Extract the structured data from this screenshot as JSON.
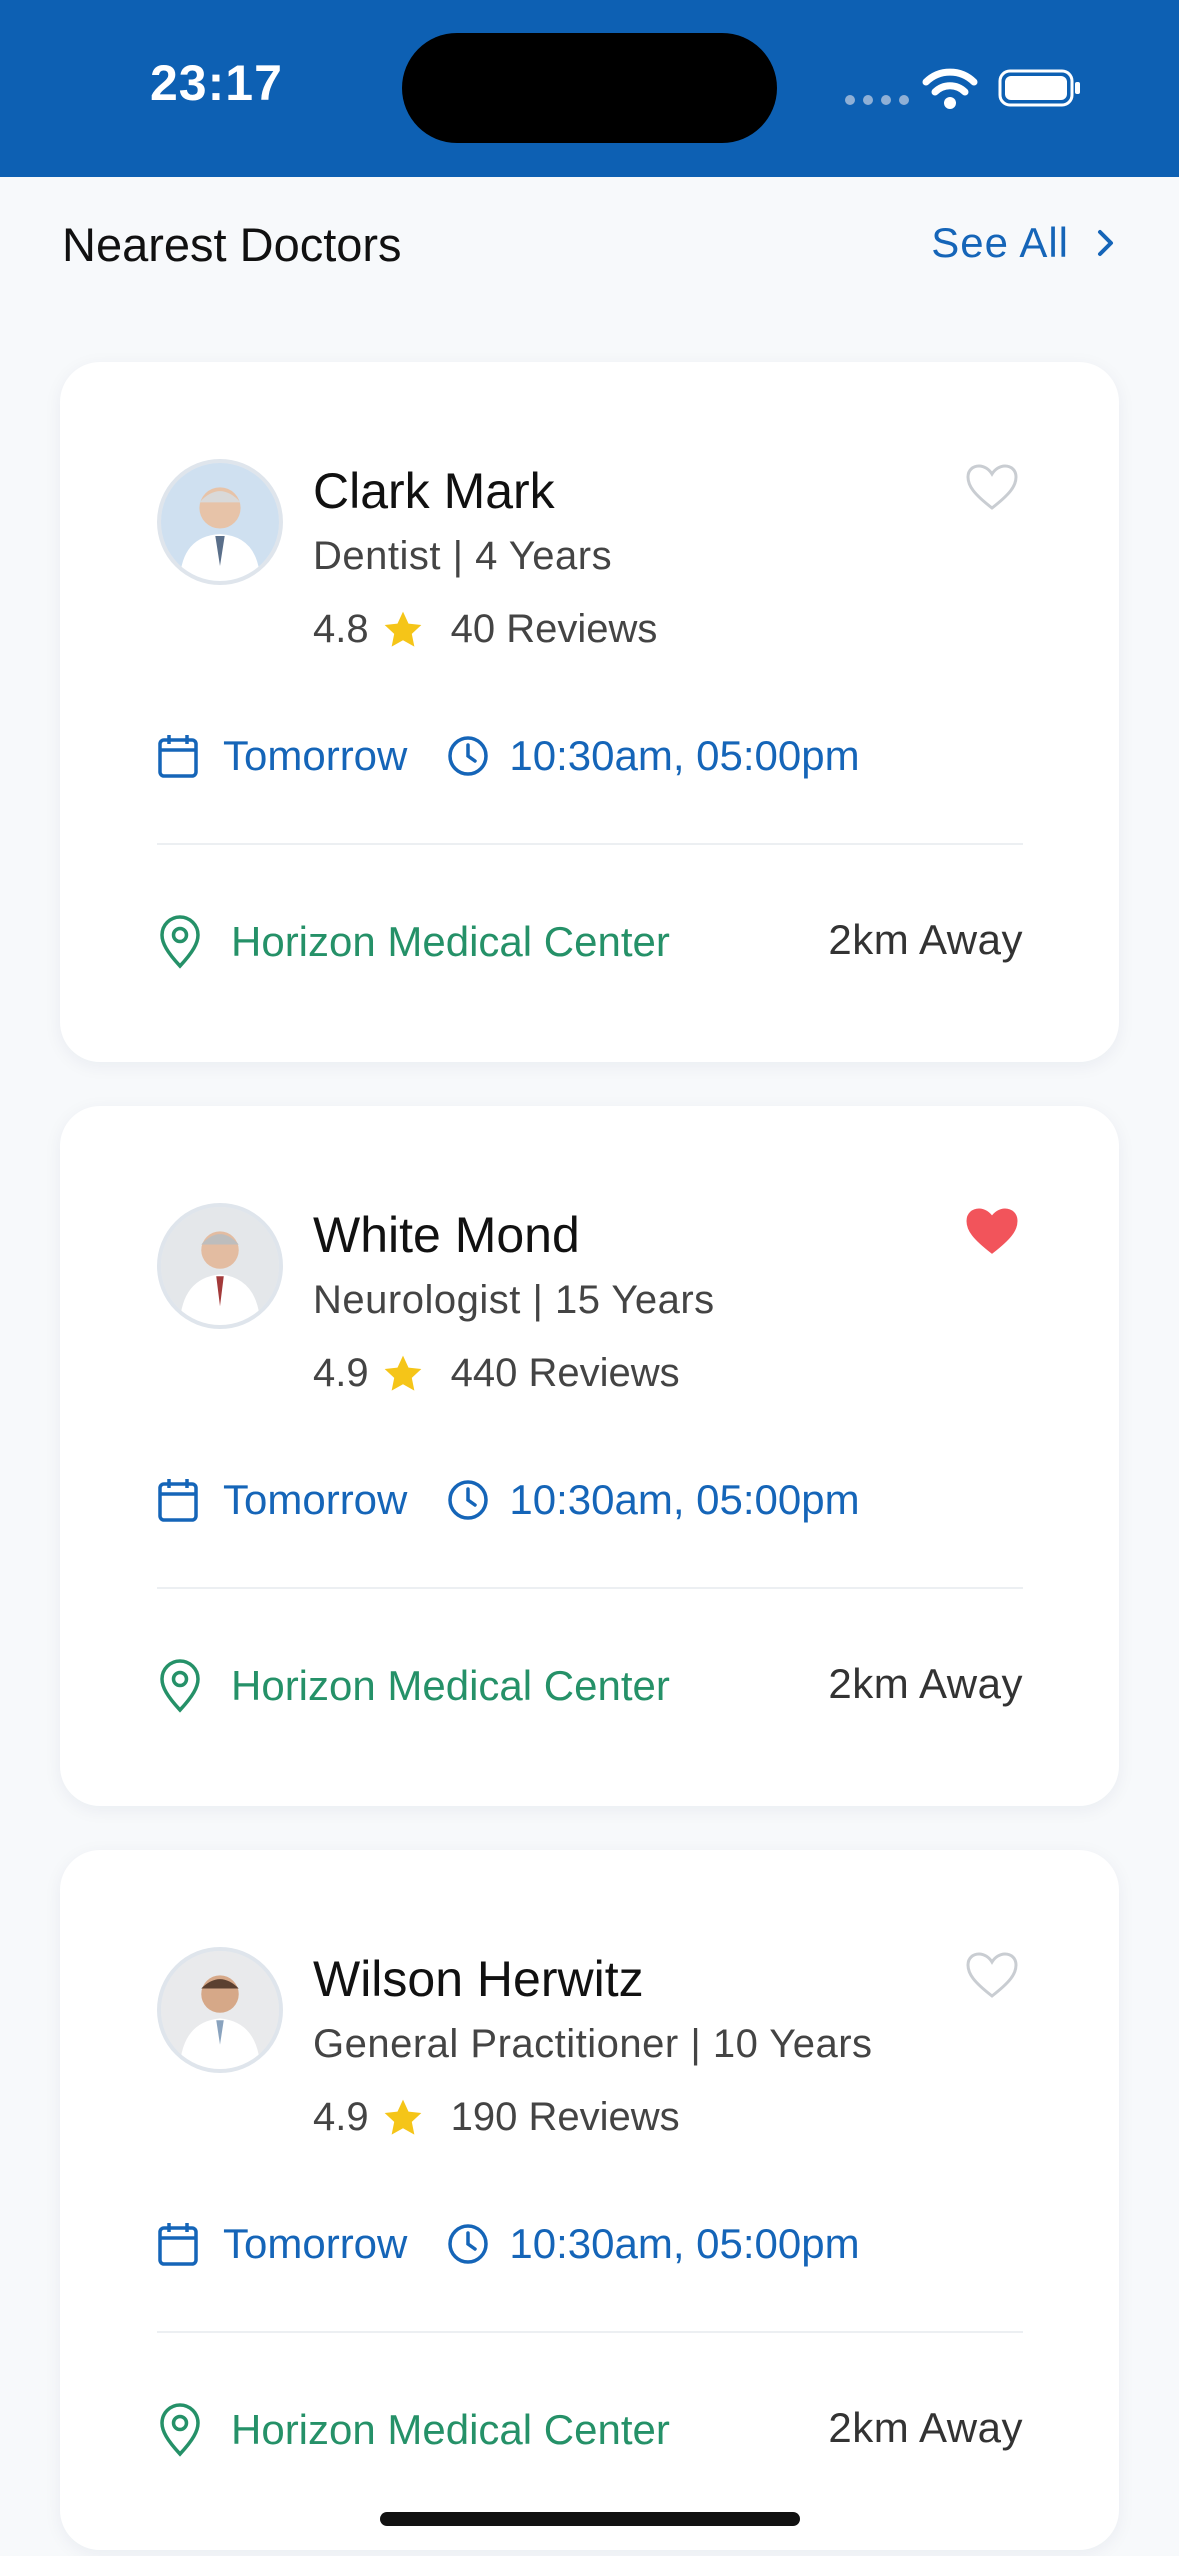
{
  "status_bar": {
    "time": "23:17"
  },
  "section": {
    "title": "Nearest Doctors",
    "see_all": "See All"
  },
  "doctors": [
    {
      "name": "Clark Mark",
      "specialty": "Dentist | 4 Years",
      "rating": "4.8",
      "reviews": "40 Reviews",
      "favorite": false,
      "day": "Tomorrow",
      "times": "10:30am, 05:00pm",
      "location": "Horizon Medical Center",
      "distance": "2km Away"
    },
    {
      "name": "White Mond",
      "specialty": "Neurologist | 15 Years",
      "rating": "4.9",
      "reviews": "440 Reviews",
      "favorite": true,
      "day": "Tomorrow",
      "times": "10:30am, 05:00pm",
      "location": "Horizon Medical Center",
      "distance": "2km Away"
    },
    {
      "name": "Wilson Herwitz",
      "specialty": "General Practitioner | 10 Years",
      "rating": "4.9",
      "reviews": "190 Reviews",
      "favorite": false,
      "day": "Tomorrow",
      "times": "10:30am, 05:00pm",
      "location": "Horizon Medical Center",
      "distance": "2km Away"
    }
  ],
  "colors": {
    "primary": "#0d60b3",
    "link": "#1565b8",
    "location": "#259168",
    "favorite": "#f2545b",
    "star": "#f5c518"
  }
}
